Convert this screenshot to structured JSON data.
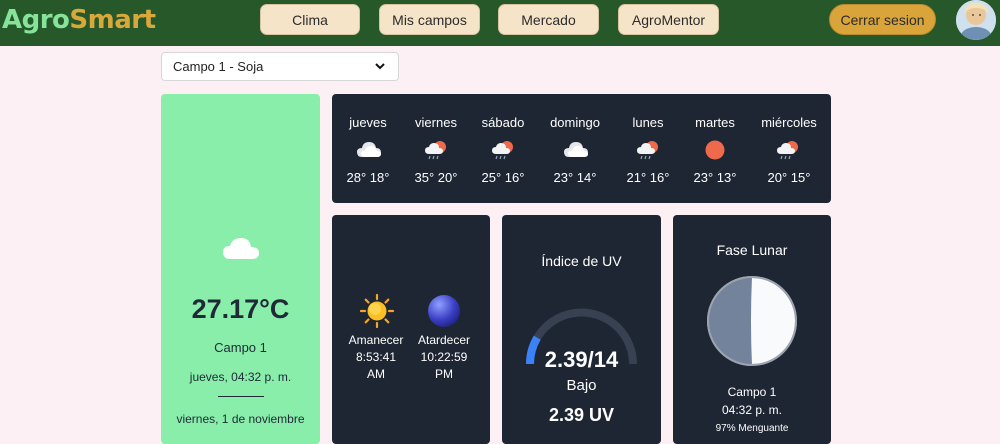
{
  "app": {
    "logo_part1": "Agro",
    "logo_part2": "Smart"
  },
  "nav": {
    "clima": "Clima",
    "mis_campos": "Mis campos",
    "mercado": "Mercado",
    "agromentor": "AgroMentor",
    "logout": "Cerrar sesion"
  },
  "field_select": {
    "value": "Campo 1 - Soja"
  },
  "current": {
    "icon": "cloud-icon",
    "temperature": "27.17°C",
    "field": "Campo 1",
    "time": "jueves, 04:32 p. m.",
    "date": "viernes, 1 de noviembre"
  },
  "forecast": [
    {
      "day": "jueves",
      "temps": "28° 18°",
      "icon": "cloudy-icon"
    },
    {
      "day": "viernes",
      "temps": "35° 20°",
      "icon": "rain-sun-icon"
    },
    {
      "day": "sábado",
      "temps": "25° 16°",
      "icon": "rain-sun-icon"
    },
    {
      "day": "domingo",
      "temps": "23° 14°",
      "icon": "cloudy-icon"
    },
    {
      "day": "lunes",
      "temps": "21° 16°",
      "icon": "rain-sun-icon"
    },
    {
      "day": "martes",
      "temps": "23° 13°",
      "icon": "sun-icon"
    },
    {
      "day": "miércoles",
      "temps": "20° 15°",
      "icon": "rain-sun-icon"
    }
  ],
  "sun": {
    "sunrise_label": "Amanecer",
    "sunrise_time": "8:53:41",
    "sunrise_ampm": "AM",
    "sunset_label": "Atardecer",
    "sunset_time": "10:22:59",
    "sunset_ampm": "PM"
  },
  "uv": {
    "title": "Índice de UV",
    "value_fraction": "2.39/14",
    "level": "Bajo",
    "value_units": "2.39 UV",
    "value": 2.39,
    "max": 14
  },
  "moon": {
    "title": "Fase Lunar",
    "field": "Campo 1",
    "time": "04:32 p. m.",
    "phase": "97% Menguante"
  },
  "colors": {
    "header": "#27582a",
    "card_dark": "#1e2533",
    "card_green": "#88eeaa",
    "accent_gold": "#d9a43a",
    "uv_arc": "#3b82f6"
  }
}
